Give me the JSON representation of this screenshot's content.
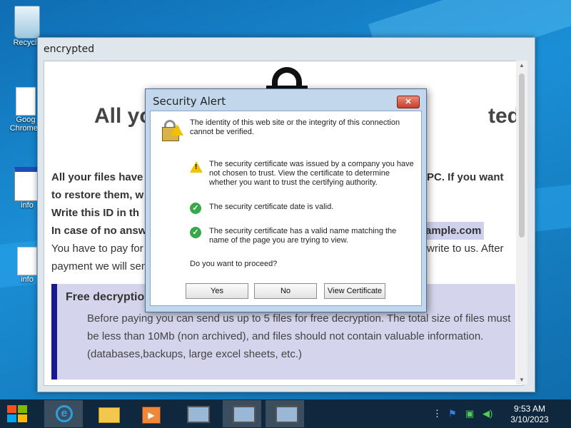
{
  "desktop": {
    "icons": [
      {
        "label": "Recycle"
      },
      {
        "label": "Goog\nChrome.l"
      },
      {
        "label": "info"
      },
      {
        "label": "info"
      }
    ]
  },
  "main_window": {
    "title": "encrypted",
    "headline_left": "All yo",
    "headline_right": "ted!",
    "paragraphs": [
      {
        "text": "All your files have",
        "tail": "PC. If you want"
      },
      {
        "text": "to restore them, w"
      },
      {
        "text": "Write this ID in th"
      },
      {
        "text": "In case of no answ",
        "tail": "ample.com"
      },
      {
        "text": "You have to pay for",
        "tail": "write to us. After"
      },
      {
        "text": "payment we will send"
      }
    ],
    "free_box": {
      "title": "Free decryption",
      "text": "Before paying you can send us up to 5 files for free decryption. The total size of files must be less than 10Mb (non archived), and files should not contain valuable information. (databases,backups, large excel sheets, etc.)"
    }
  },
  "dialog": {
    "title": "Security Alert",
    "close_label": "✕",
    "intro": "The identity of this web site or the integrity of this connection cannot be verified.",
    "items": [
      {
        "type": "warning",
        "text": "The security certificate was issued by a company you have not chosen to trust. View the certificate to determine whether you want to trust the certifying authority."
      },
      {
        "type": "ok",
        "text": "The security certificate date is valid."
      },
      {
        "type": "ok",
        "text": "The security certificate has a valid name matching the name of the page you are trying to view."
      }
    ],
    "question": "Do you want to proceed?",
    "buttons": {
      "yes": "Yes",
      "no": "No",
      "view": "View Certificate"
    }
  },
  "taskbar": {
    "clock_time": "9:53 AM",
    "clock_date": "3/10/2023"
  },
  "colors": {
    "accent": "#1a1a8e",
    "taskbar": "#10283e"
  }
}
